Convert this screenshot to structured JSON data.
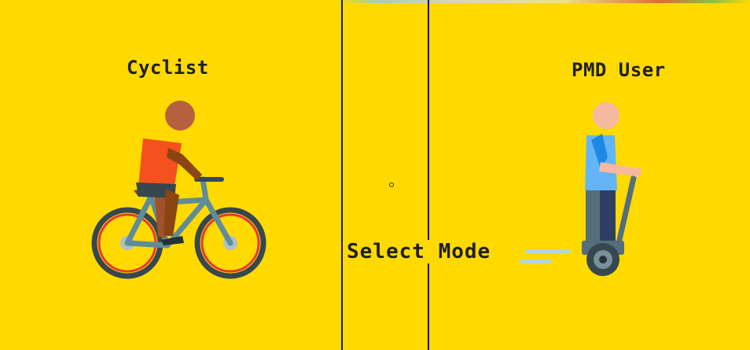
{
  "screen": {
    "heading": "Select Mode",
    "background_color": "#FFDA00"
  },
  "modes": [
    {
      "id": "cyclist",
      "label": "Cyclist",
      "icon": "cyclist-icon"
    },
    {
      "id": "pmd",
      "label": "PMD User",
      "icon": "pmd-user-icon"
    }
  ]
}
